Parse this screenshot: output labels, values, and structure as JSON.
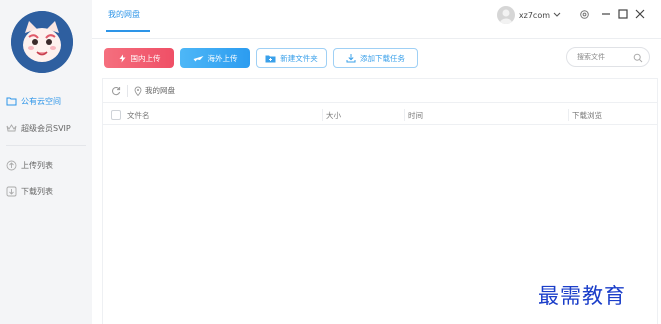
{
  "sidebar": {
    "items": [
      {
        "label": "公有云空间",
        "icon": "folder-icon",
        "active": true
      },
      {
        "label": "超级会员SVIP",
        "icon": "crown-icon",
        "active": false
      },
      {
        "label": "上传列表",
        "icon": "upload-list-icon",
        "active": false
      },
      {
        "label": "下载列表",
        "icon": "download-list-icon",
        "active": false
      }
    ]
  },
  "header": {
    "tab": "我的网盘",
    "username": "xz7com",
    "controls": [
      "settings-icon",
      "minimize-icon",
      "maximize-icon",
      "close-icon"
    ]
  },
  "toolbar": {
    "domestic_upload": "国内上传",
    "overseas_upload": "海外上传",
    "new_folder": "新建文件夹",
    "add_download": "添加下载任务",
    "search_placeholder": "搜索文件"
  },
  "breadcrumb": {
    "path": "我的网盘"
  },
  "table": {
    "columns": [
      "文件名",
      "大小",
      "时间",
      "下载浏览"
    ]
  },
  "watermark": "最需教育",
  "colors": {
    "accent": "#2d95e8",
    "domestic_button": "#ef4f66",
    "overseas_button": "#2c9cf0",
    "sidebar_bg": "#f4f5f7"
  }
}
